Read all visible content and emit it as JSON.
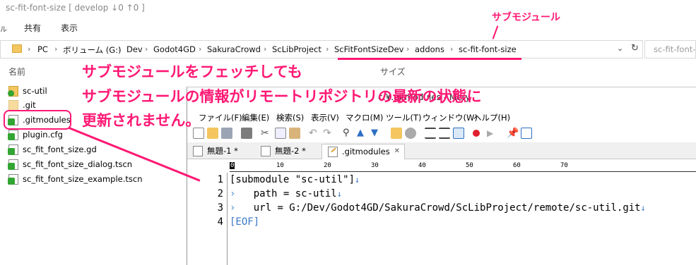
{
  "explorer": {
    "title": "sc-fit-font-size [ develop ↓0 ↑0 ]",
    "ribbon_tabs": [
      "共有",
      "表示"
    ],
    "address": [
      "PC",
      "ボリューム (G:)",
      "Dev",
      "Godot4GD",
      "SakuraCrowd",
      "ScLibProject",
      "ScFitFontSizeDev",
      "addons",
      "sc-fit-font-size"
    ],
    "search_placeholder": "sc-fit-font-",
    "columns": {
      "name": "名前",
      "size": "サイズ"
    },
    "files": [
      {
        "name": "sc-util",
        "icon": "folder-ok-icon"
      },
      {
        "name": ".git",
        "icon": "folder-icon"
      },
      {
        "name": ".gitmodules",
        "icon": "file-modified-icon"
      },
      {
        "name": "plugin.cfg",
        "icon": "file-modified-icon"
      },
      {
        "name": "sc_fit_font_size.gd",
        "icon": "file-modified-icon"
      },
      {
        "name": "sc_fit_font_size_dialog.tscn",
        "icon": "file-modified-icon"
      },
      {
        "name": "sc_fit_font_size_example.tscn",
        "icon": "file-modified-icon"
      }
    ]
  },
  "mery": {
    "title": "c:¥.gitmodules - Mery",
    "menu": [
      "ファイル(F)",
      "編集(E)",
      "検索(S)",
      "表示(V)",
      "マクロ(M)",
      "ツール(T)",
      "ウィンドウ(W)",
      "ヘルプ(H)"
    ],
    "tabs": [
      {
        "label": "無題-1 *",
        "active": false
      },
      {
        "label": "無題-2 *",
        "active": false
      },
      {
        "label": ".gitmodules",
        "active": true
      }
    ],
    "ruler": [
      "0",
      "10",
      "20",
      "30",
      "40",
      "50",
      "60",
      "70"
    ],
    "line_numbers": [
      "1",
      "2",
      "3",
      "4"
    ],
    "code": [
      {
        "tab": "",
        "text": "[submodule \"sc-util\"]"
      },
      {
        "tab": "›",
        "text": "path = sc-util"
      },
      {
        "tab": "›",
        "text": "url = G:/Dev/Godot4GD/SakuraCrowd/ScLibProject/remote/sc-util.git"
      },
      {
        "tab": "",
        "text": "[EOF]"
      }
    ]
  },
  "annotations": {
    "top_label": "サブモジュール",
    "line1": "サブモジュールをフェッチしても",
    "line2": "サブモジュールの情報がリモートリポジトリの最新の状態に",
    "line3": "更新されません。"
  },
  "colors": {
    "annotation": "#ff1874",
    "eol": "#3a78c4"
  }
}
